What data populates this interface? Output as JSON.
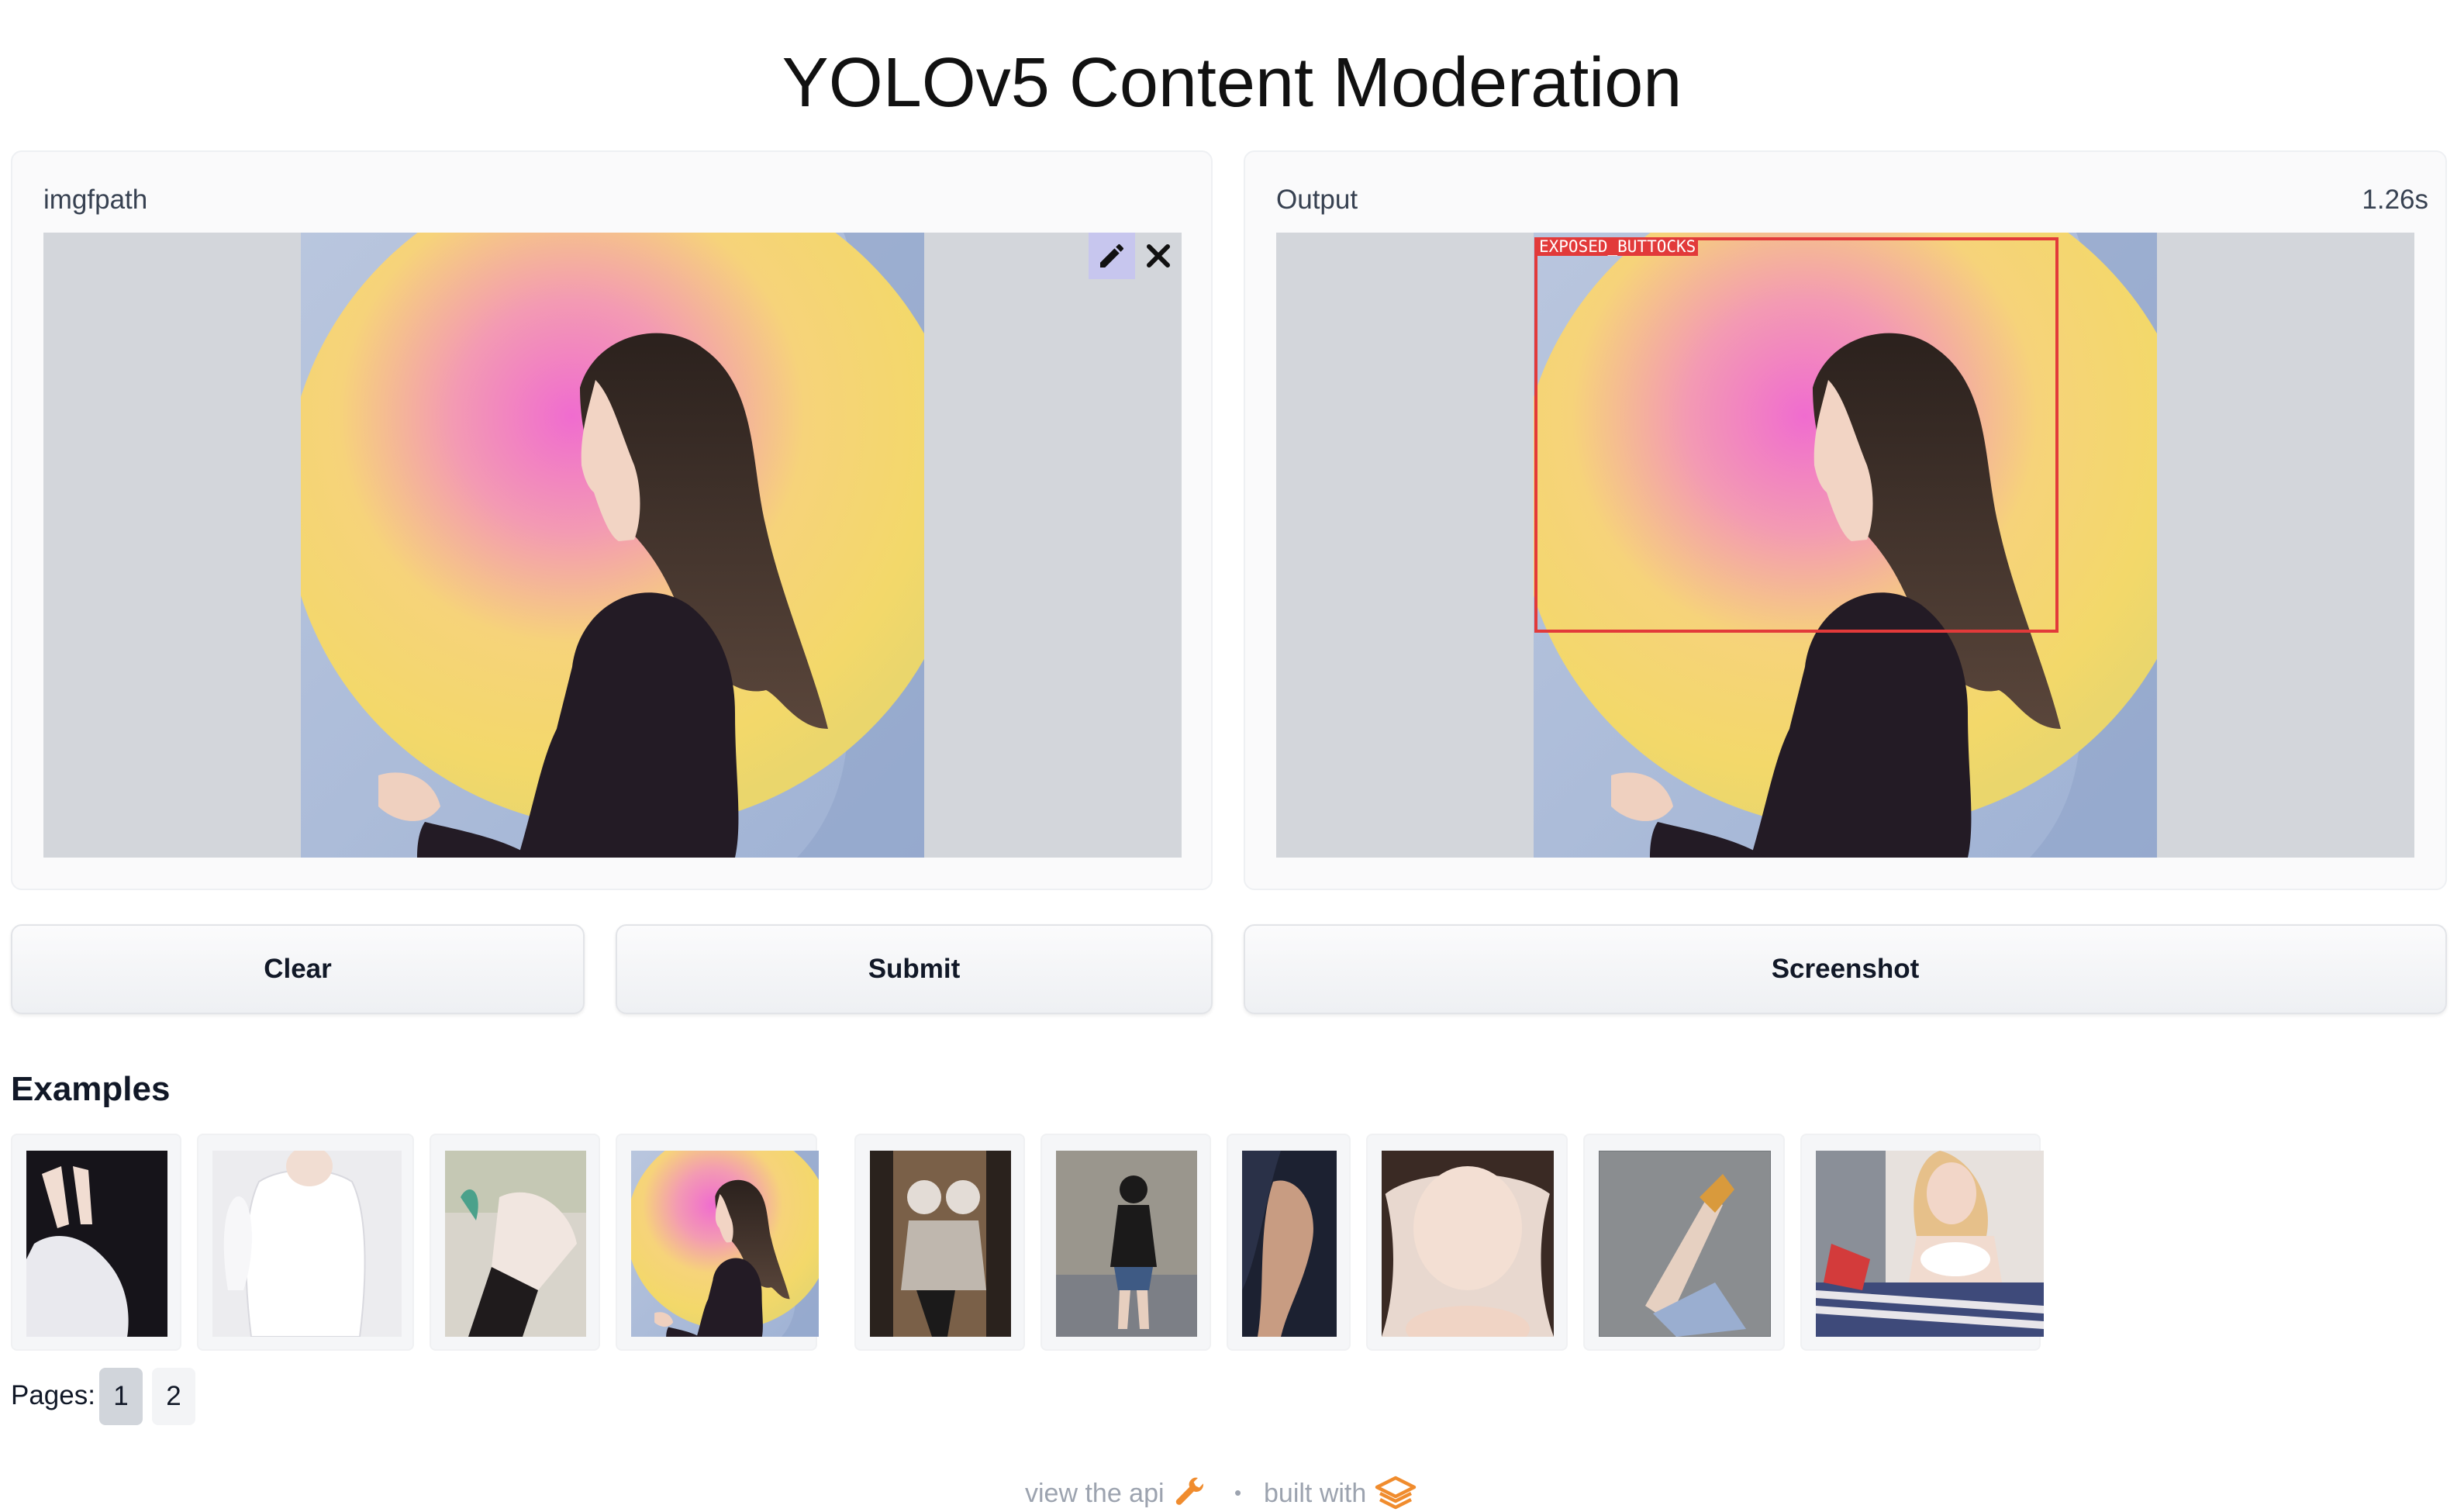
{
  "title": "YOLOv5 Content Moderation",
  "input_panel": {
    "label": "imgfpath"
  },
  "output_panel": {
    "label": "Output",
    "time": "1.26s",
    "detection_label": "EXPOSED_BUTTOCKS"
  },
  "buttons": {
    "clear": "Clear",
    "submit": "Submit",
    "screenshot": "Screenshot"
  },
  "examples": {
    "title": "Examples",
    "count": 10
  },
  "pagination": {
    "label": "Pages:",
    "pages": [
      "1",
      "2"
    ],
    "current": "1"
  },
  "footer": {
    "api_text": "view the api",
    "separator": "•",
    "built_with": "built with"
  },
  "colors": {
    "detection_box": "#e23a3a",
    "edit_tool_active": "#c7c6ee",
    "image_background": "#d3d6db",
    "wrench_icon": "#f08c2e"
  },
  "icons": [
    "pencil-icon",
    "close-icon",
    "wrench-icon",
    "gradio-logo"
  ]
}
